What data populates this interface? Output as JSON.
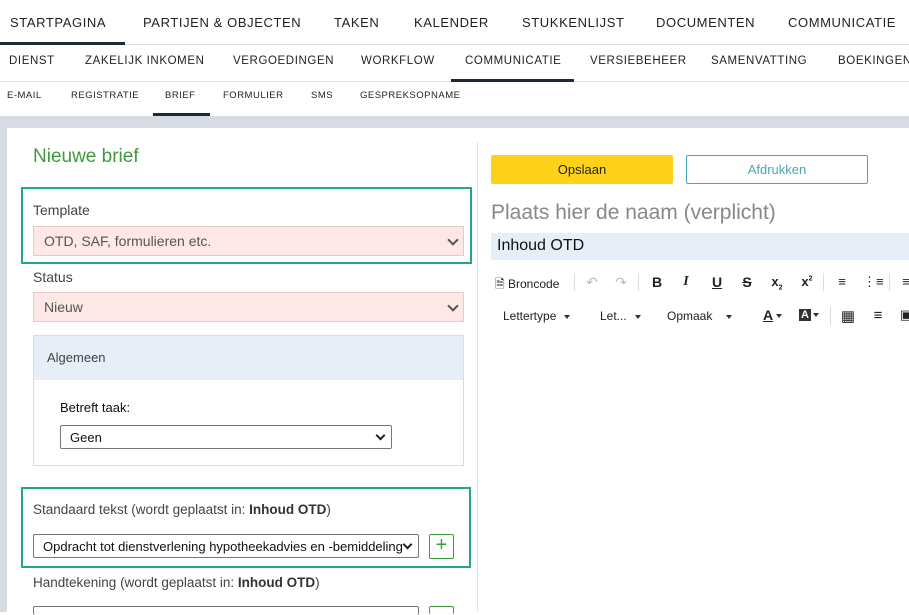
{
  "nav_main": [
    "STARTPAGINA",
    "PARTIJEN & OBJECTEN",
    "TAKEN",
    "KALENDER",
    "STUKKENLIJST",
    "DOCUMENTEN",
    "COMMUNICATIE"
  ],
  "nav_sub": [
    "DIENST",
    "ZAKELIJK INKOMEN",
    "VERGOEDINGEN",
    "WORKFLOW",
    "COMMUNICATIE",
    "VERSIEBEHEER",
    "SAMENVATTING",
    "BOEKINGEN"
  ],
  "nav_tertiary": [
    "E-MAIL",
    "REGISTRATIE",
    "BRIEF",
    "FORMULIER",
    "SMS",
    "GESPREKSOPNAME"
  ],
  "form": {
    "title": "Nieuwe brief",
    "template_label": "Template",
    "template_value": "OTD, SAF, formulieren etc.",
    "status_label": "Status",
    "status_value": "Nieuw",
    "general_header": "Algemeen",
    "task_label": "Betreft taak:",
    "task_value": "Geen",
    "std_text_label": "Standaard tekst (wordt geplaatst in: ",
    "std_text_target": "Inhoud OTD",
    "std_text_close": ")",
    "std_text_value": "Opdracht tot dienstverlening hypotheekadvies en -bemiddeling",
    "signature_label": "Handtekening (wordt geplaatst in: ",
    "signature_target": "Inhoud OTD",
    "signature_close": ")"
  },
  "editor": {
    "save_label": "Opslaan",
    "print_label": "Afdrukken",
    "name_placeholder": "Plaats hier de naam (verplicht)",
    "content_title": "Inhoud OTD",
    "source_label": "Broncode",
    "font_label": "Lettertype",
    "size_label": "Let...",
    "format_label": "Opmaak"
  },
  "colors": {
    "accent_green": "#3f9a3f",
    "highlight_teal": "#1fa98b",
    "save_yellow": "#ffd21a",
    "print_teal": "#4aa6b5",
    "required_pink": "#fde7e7"
  }
}
